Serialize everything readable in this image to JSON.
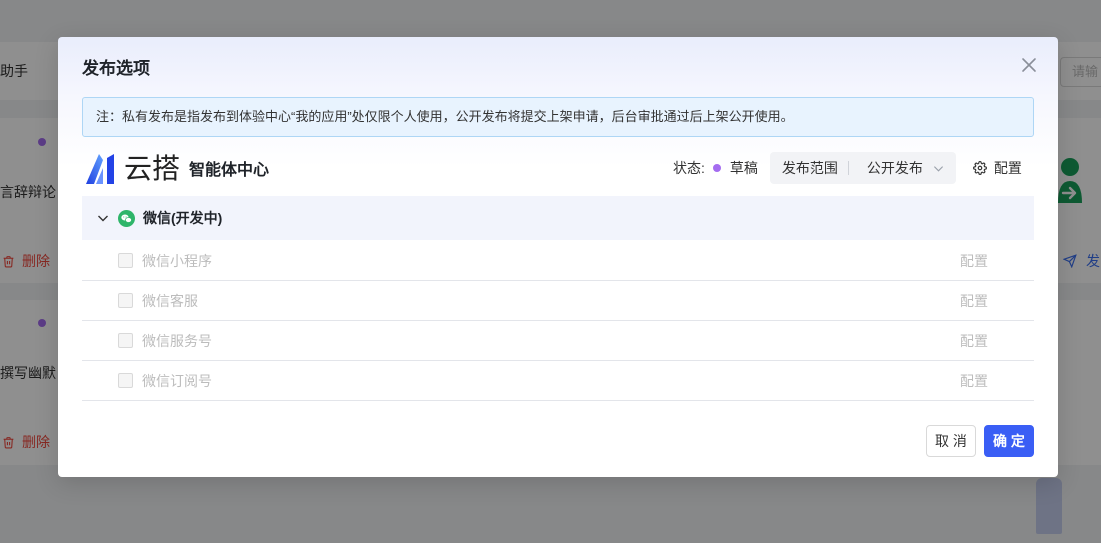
{
  "background": {
    "header_title": "助手",
    "search_placeholder": "请输",
    "cards": [
      {
        "description": "言辞辩论",
        "delete_label": "删除",
        "publish_label": "发"
      },
      {
        "description": "撰写幽默",
        "delete_label": "删除"
      }
    ]
  },
  "modal": {
    "title": "发布选项",
    "notice": "注：私有发布是指发布到体验中心“我的应用”处仅限个人使用，公开发布将提交上架申请，后台审批通过后上架公开使用。",
    "brand": {
      "name": "云搭",
      "subtitle": "智能体中心"
    },
    "status": {
      "label": "状态:",
      "value": "草稿"
    },
    "scope": {
      "label": "发布范围",
      "value": "公开发布"
    },
    "config_label": "配置",
    "channel_group": {
      "title": "微信(开发中)",
      "icon": "wechat-icon",
      "expanded": true,
      "items": [
        {
          "name": "微信小程序",
          "config_label": "配置",
          "checked": false,
          "disabled": true
        },
        {
          "name": "微信客服",
          "config_label": "配置",
          "checked": false,
          "disabled": true
        },
        {
          "name": "微信服务号",
          "config_label": "配置",
          "checked": false,
          "disabled": true
        },
        {
          "name": "微信订阅号",
          "config_label": "配置",
          "checked": false,
          "disabled": true
        }
      ]
    },
    "buttons": {
      "cancel": "取 消",
      "confirm": "确 定"
    }
  },
  "colors": {
    "accent": "#3a5ef5",
    "status_dot": "#a46cf0",
    "wechat_green": "#2fb56a",
    "danger": "#f0483e",
    "send_blue": "#3a6ff0",
    "avatar_green": "#1aa05c"
  }
}
